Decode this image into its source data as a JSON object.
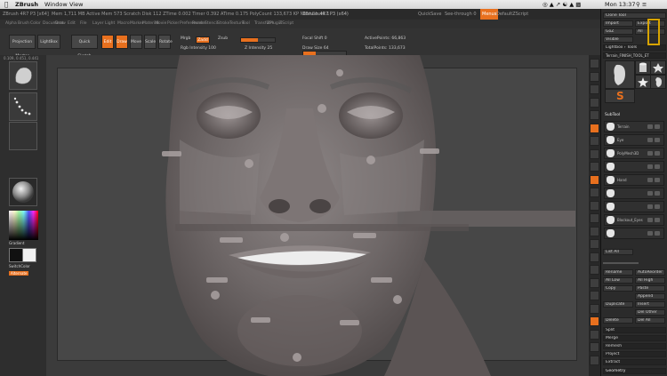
{
  "mac_menu": {
    "app": "ZBrush",
    "window": "Window",
    "view": "View",
    "clock": "Mon 13:37"
  },
  "title_bar": {
    "left": "ZBrush 4R7 P3 [x64]",
    "mid": "Mem 1,711 MB   Active Mem 573   Scratch Disk 112   ZTime 0.002   Timer 0.392   ATime 0.175   PolyCount 133,673 KP   MeshCount 1",
    "title": "ZBrush 4R7 P3 (x64)",
    "spotlight": "QuickSave",
    "interface": "See-through 0",
    "menus": "Menus",
    "default": "DefaultZScript"
  },
  "menu_bar": {
    "items": [
      "Alpha",
      "Brush",
      "Color",
      "Document",
      "Draw",
      "Edit",
      "File",
      "Layer",
      "Light",
      "Macro",
      "Marker",
      "Material",
      "Movie",
      "Picker",
      "Preferences",
      "Render",
      "Stencil",
      "Stroke",
      "Texture",
      "Tool",
      "Transform",
      "ZPlugin",
      "ZScript"
    ]
  },
  "toolbar": {
    "projection_master": "Projection Master",
    "lightbox": "LightBox",
    "quick_sketch": "Quick Sketch",
    "edit": "Edit",
    "draw": "Draw",
    "move": "Move",
    "scale": "Scale",
    "rotate": "Rotate",
    "mrgb": "Mrgb",
    "rgb": "Rgb",
    "m": "M",
    "zadd": "Zadd",
    "zsub": "Zsub",
    "focal_shift": "Focal Shift 0",
    "draw_size": "Draw Size 64",
    "rgb_intensity": "Rgb Intensity 100",
    "z_intensity": "Z Intensity 25",
    "active_points": "ActivePoints: 66,863",
    "total_points": "TotalPoints: 133,673",
    "coords": "0.109, 0.451, 0.441"
  },
  "left_shelf": {
    "gradient": "Gradient",
    "switch_color": "SwitchColor",
    "alternate": "Alternate"
  },
  "right_panel": {
    "clone_tool": "Clone Tool",
    "import": "Import",
    "export": "Export",
    "goz": "GoZ",
    "all": "All",
    "visible": "Visible",
    "lightbox_tools": "Lightbox › Tools",
    "tool_name": "Terrain_FINISH_TOOL_ET",
    "subtool_header": "SubTool",
    "subtool_items": [
      "Terrain",
      "Eye",
      "PolyMesh3D",
      "",
      "Hand",
      "",
      "",
      "Blockout_Eyes",
      ""
    ],
    "list_all": "List All",
    "rename": "Rename",
    "autoreorder": "AutoReorder",
    "all_low": "All Low",
    "all_high": "All High",
    "copy": "Copy",
    "paste": "Paste",
    "append": "Append",
    "duplicate": "Duplicate",
    "insert": "Insert",
    "del_other": "Del Other",
    "delete": "Delete",
    "del_all": "Del All",
    "split": "Split",
    "merge": "Merge",
    "remesh": "Remesh",
    "project": "Project",
    "extract": "Extract",
    "geometry": "Geometry"
  }
}
